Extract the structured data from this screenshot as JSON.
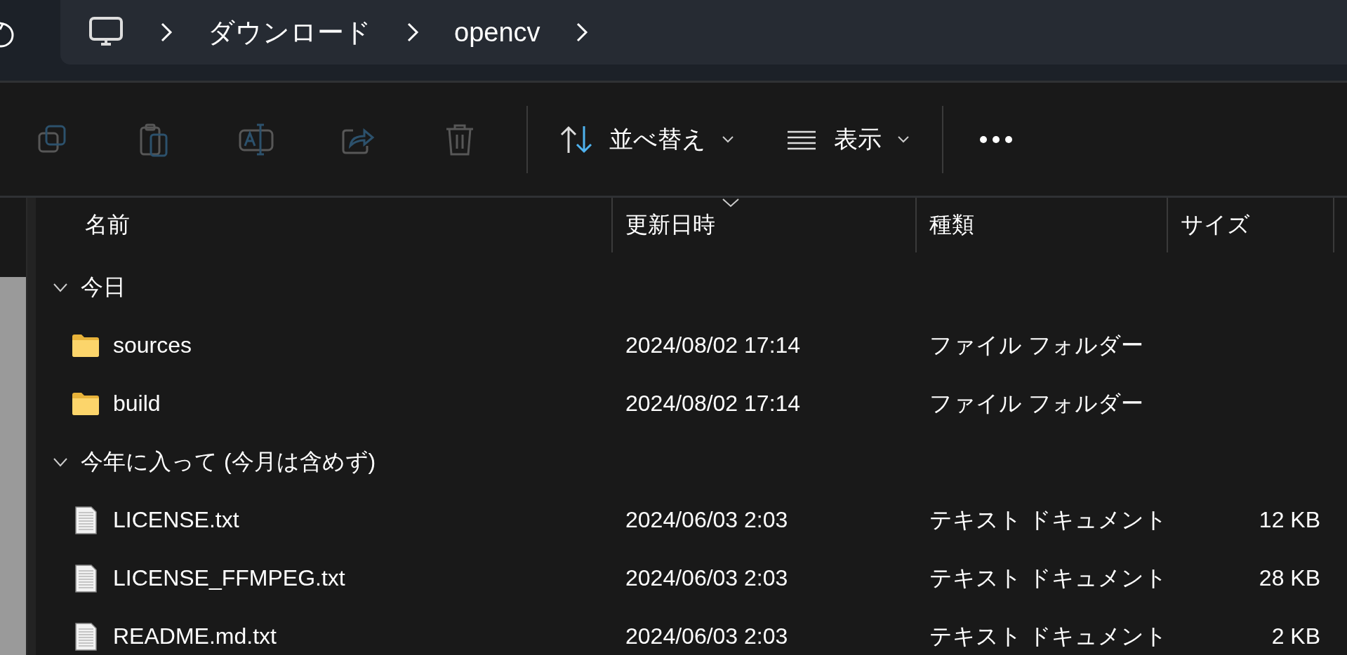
{
  "breadcrumb": {
    "items": [
      "ダウンロード",
      "opencv"
    ]
  },
  "toolbar": {
    "actions": [
      {
        "kind": "copy",
        "disabled": true
      },
      {
        "kind": "paste",
        "disabled": true
      },
      {
        "kind": "rename",
        "disabled": true
      },
      {
        "kind": "share",
        "disabled": true
      },
      {
        "kind": "delete",
        "disabled": true
      }
    ],
    "sort_label": "並べ替え",
    "view_label": "表示"
  },
  "columns": [
    {
      "label": "名前",
      "sorted": false
    },
    {
      "label": "更新日時",
      "sorted": true
    },
    {
      "label": "種類",
      "sorted": false
    },
    {
      "label": "サイズ",
      "sorted": false
    }
  ],
  "groups": [
    {
      "label": "今日",
      "expanded": true,
      "items": [
        {
          "kind": "folder",
          "name": "sources",
          "date": "2024/08/02 17:14",
          "type": "ファイル フォルダー"
        },
        {
          "kind": "folder",
          "name": "build",
          "date": "2024/08/02 17:14",
          "type": "ファイル フォルダー"
        }
      ]
    },
    {
      "label": "今年に入って (今月は含めず)",
      "expanded": true,
      "items": [
        {
          "kind": "text",
          "name": "LICENSE.txt",
          "date": "2024/06/03 2:03",
          "type": "テキスト ドキュメント",
          "size": "12 KB"
        },
        {
          "kind": "text",
          "name": "LICENSE_FFMPEG.txt",
          "date": "2024/06/03 2:03",
          "type": "テキスト ドキュメント",
          "size": "28 KB"
        },
        {
          "kind": "text",
          "name": "README.md.txt",
          "date": "2024/06/03 2:03",
          "type": "テキスト ドキュメント",
          "size": "2 KB"
        }
      ]
    }
  ]
}
